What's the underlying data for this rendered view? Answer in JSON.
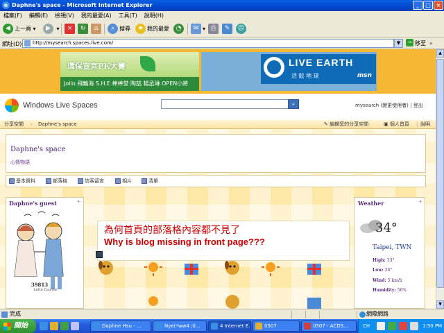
{
  "window": {
    "title": "Daphne's space - Microsoft Internet Explorer",
    "controls": {
      "minimize": "_",
      "maximize": "□",
      "close": "×"
    }
  },
  "menu": [
    "檔案(F)",
    "編輯(E)",
    "檢視(V)",
    "我的最愛(A)",
    "工具(T)",
    "說明(H)"
  ],
  "toolbar": {
    "back": "上一頁",
    "search": "搜尋",
    "favorites": "我的最愛"
  },
  "address": {
    "label": "網址(D)",
    "url": "http://mysearch.spaces.live.com/",
    "go": "移至",
    "links": "»"
  },
  "banner_left": {
    "headline": "環保宣言PK大賽",
    "names": "Jolin 飛輪海 S.H.E 棒棒堂 陶喆 楊丞琳 OPEN小將"
  },
  "banner_right": {
    "title": "LIVE EARTH",
    "subtitle": "活 飲 地 球",
    "brand": "msn"
  },
  "header": {
    "brand": "Windows Live Spaces",
    "search_btn": "⌕",
    "user": "mysearch (變更使用者) | 登出"
  },
  "nav": {
    "breadcrumb_root": "分享空間",
    "breadcrumb_current": "Daphne's space",
    "edit": "編輯您的分享空間",
    "profile": "個人首頁",
    "help": "說明"
  },
  "space": {
    "title": "Daphne's space",
    "subtitle": "心情物語"
  },
  "tabs": [
    "基本資料",
    "部落格",
    "訪客留言",
    "相片",
    "清單"
  ],
  "guest": {
    "title": "Daphne's guest",
    "counter": "39813",
    "counter_label": "Lette Counter",
    "plus": "+"
  },
  "weather": {
    "title": "Weather",
    "plus": "+",
    "temp": "34°",
    "city": "Taipei, TWN",
    "high_label": "High:",
    "high": "33°",
    "low_label": "Low:",
    "low": "26°",
    "wind_label": "Wind:",
    "wind": "5 km/h",
    "humidity_label": "Humidity:",
    "humidity": "56%"
  },
  "annotation": {
    "cn": "為何首頁的部落格內容都不見了",
    "en": "Why is blog missing in front page???"
  },
  "status": {
    "text": "完成",
    "zone": "網際網路"
  },
  "taskbar": {
    "start": "開始",
    "tasks": [
      "Daphne Hsu - ...",
      "Nye(*ww4 ;0...",
      "4 Internet E...",
      "0507",
      "0507 - ACDS..."
    ],
    "lang": "CH",
    "clock": "1:30 PM"
  },
  "colors": {
    "accent": "#f6b733",
    "title_purple": "#4a2270",
    "annotation_red": "#cc0000"
  }
}
